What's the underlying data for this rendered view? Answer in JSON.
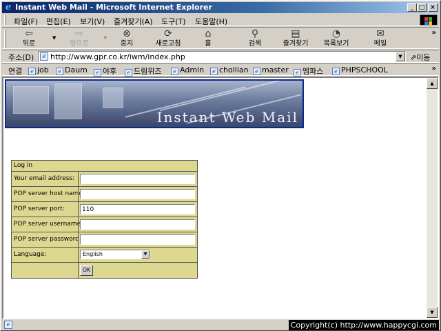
{
  "window": {
    "title": "Instant Web Mail - Microsoft Internet Explorer",
    "minimize": "_",
    "maximize": "□",
    "close": "×"
  },
  "menubar": {
    "items": [
      "파일(F)",
      "편집(E)",
      "보기(V)",
      "즐겨찾기(A)",
      "도구(T)",
      "도움말(H)"
    ]
  },
  "toolbar": {
    "back": "뒤로",
    "forward": "앞으로",
    "stop": "중지",
    "refresh": "새로고침",
    "home": "홈",
    "search": "검색",
    "favorites": "즐겨찾기",
    "history": "목록보기",
    "mail": "메일",
    "more": "»"
  },
  "address": {
    "label": "주소(D)",
    "url": "http://www.gpr.co.kr/iwm/index.php",
    "go": "이동"
  },
  "links": {
    "label": "연결",
    "items": [
      "job",
      "Daum",
      "야후",
      "드림위즈",
      "Admin",
      "chollian",
      "master",
      "엠파스",
      "PHPSCHOOL"
    ],
    "more": "»"
  },
  "banner": {
    "title": "Instant Web Mail"
  },
  "login": {
    "header": "Log in",
    "email_label": "Your email address:",
    "email_value": "",
    "host_label": "POP server host name:",
    "host_value": "",
    "port_label": "POP server port:",
    "port_value": "110",
    "user_label": "POP server username:",
    "user_value": "",
    "pass_label": "POP server password:",
    "pass_value": "",
    "language_label": "Language:",
    "language_value": "English",
    "ok": "OK"
  },
  "status": {
    "copyright": "Copyright(c) http://www.happycgi.com"
  },
  "icons": {
    "browser": "ie-icon",
    "back": "back-arrow-icon",
    "forward": "forward-arrow-icon",
    "stop": "stop-icon",
    "refresh": "refresh-icon",
    "home": "home-icon",
    "search": "search-icon",
    "favorites": "favorites-icon",
    "history": "history-icon",
    "mail": "mail-icon"
  }
}
